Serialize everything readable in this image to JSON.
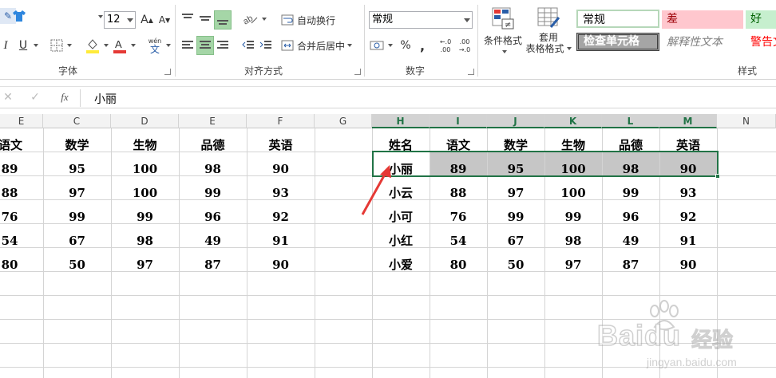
{
  "ribbon": {
    "font": {
      "size": "12",
      "bold": "I",
      "underline": "U",
      "grow": "A",
      "shrink": "A",
      "phonetic_top": "wén",
      "phonetic_bottom": "文",
      "group_label": "字体"
    },
    "alignment": {
      "wrap_label": "自动换行",
      "merge_label": "合并后居中",
      "group_label": "对齐方式"
    },
    "number": {
      "format": "常规",
      "percent": "%",
      "comma": ",",
      "inc_top": "←.0",
      "inc_bottom": ".00",
      "dec_top": ".00",
      "dec_bottom": "→.0",
      "group_label": "数字"
    },
    "styles": {
      "conditional_label": "条件格式",
      "table_label_1": "套用",
      "table_label_2": "表格格式",
      "normal": "常规",
      "bad": "差",
      "good": "好",
      "check_cell": "检查单元格",
      "explanatory": "解释性文本",
      "warning": "警告文",
      "group_label": "样式"
    }
  },
  "formula_bar": {
    "cancel": "✕",
    "enter": "✓",
    "fx": "fx",
    "content": "小丽"
  },
  "columns": [
    "E",
    "C",
    "D",
    "E",
    "F",
    "G",
    "H",
    "I",
    "J",
    "K",
    "L",
    "M",
    "N"
  ],
  "left_table": {
    "headers": [
      "语文",
      "数学",
      "生物",
      "品德",
      "英语"
    ],
    "rows": [
      [
        "89",
        "95",
        "100",
        "98",
        "90"
      ],
      [
        "88",
        "97",
        "100",
        "99",
        "93"
      ],
      [
        "76",
        "99",
        "99",
        "96",
        "92"
      ],
      [
        "54",
        "67",
        "98",
        "49",
        "91"
      ],
      [
        "80",
        "50",
        "97",
        "87",
        "90"
      ]
    ]
  },
  "right_table": {
    "headers": [
      "姓名",
      "语文",
      "数学",
      "生物",
      "品德",
      "英语"
    ],
    "rows": [
      [
        "小丽",
        "89",
        "95",
        "100",
        "98",
        "90"
      ],
      [
        "小云",
        "88",
        "97",
        "100",
        "99",
        "93"
      ],
      [
        "小可",
        "76",
        "99",
        "99",
        "96",
        "92"
      ],
      [
        "小红",
        "54",
        "67",
        "98",
        "49",
        "91"
      ],
      [
        "小爱",
        "80",
        "50",
        "97",
        "87",
        "90"
      ]
    ]
  },
  "watermark": {
    "brand": "Bai",
    "brand2": "du",
    "cn": "经验",
    "url": "jingyan.baidu.com"
  },
  "colors": {
    "accent": "#217346",
    "arrow": "#e53935",
    "selection_fill": "#c6c6c6",
    "bad_bg": "#ffc7ce",
    "bad_fg": "#9c0006",
    "good_bg": "#c6efce",
    "good_fg": "#006100",
    "warning_fg": "#ff0000"
  }
}
